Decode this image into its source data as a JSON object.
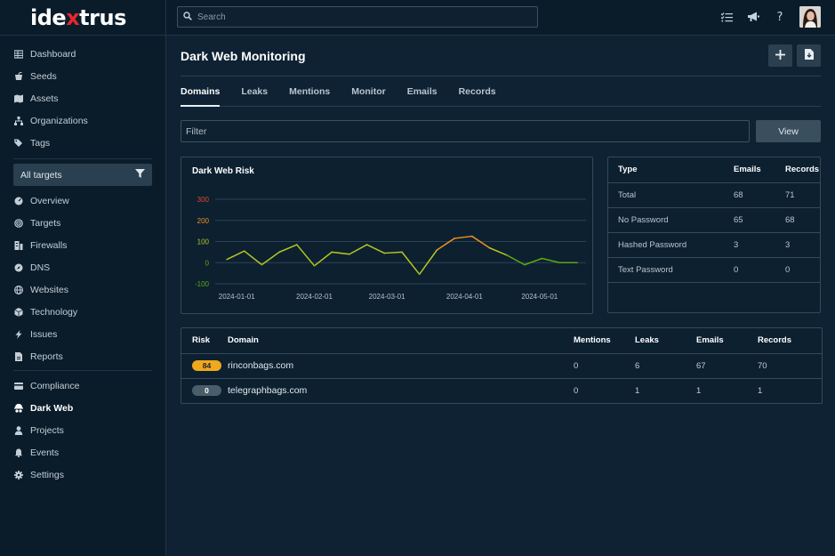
{
  "brand": {
    "logo_before": "ide",
    "logo_x": "x",
    "logo_after": "trus"
  },
  "search": {
    "placeholder": "Search"
  },
  "sidebar": {
    "group1": [
      {
        "label": "Dashboard",
        "icon": "grid-icon"
      },
      {
        "label": "Seeds",
        "icon": "seed-pot-icon"
      },
      {
        "label": "Assets",
        "icon": "map-icon"
      },
      {
        "label": "Organizations",
        "icon": "sitemap-icon"
      },
      {
        "label": "Tags",
        "icon": "tags-icon"
      }
    ],
    "target_select": "All targets",
    "group2": [
      {
        "label": "Overview",
        "icon": "gauge-icon"
      },
      {
        "label": "Targets",
        "icon": "target-icon"
      },
      {
        "label": "Firewalls",
        "icon": "firewall-icon"
      },
      {
        "label": "DNS",
        "icon": "compass-icon"
      },
      {
        "label": "Websites",
        "icon": "globe-icon"
      },
      {
        "label": "Technology",
        "icon": "cube-icon"
      },
      {
        "label": "Issues",
        "icon": "bolt-icon"
      },
      {
        "label": "Reports",
        "icon": "report-icon"
      }
    ],
    "group3": [
      {
        "label": "Compliance",
        "icon": "card-icon"
      },
      {
        "label": "Dark Web",
        "icon": "spy-icon",
        "active": true
      },
      {
        "label": "Projects",
        "icon": "person-icon"
      },
      {
        "label": "Events",
        "icon": "bell-icon"
      },
      {
        "label": "Settings",
        "icon": "gear-icon"
      }
    ]
  },
  "header": {
    "title": "Dark Web Monitoring"
  },
  "tabs": [
    "Domains",
    "Leaks",
    "Mentions",
    "Monitor",
    "Emails",
    "Records"
  ],
  "filter": {
    "placeholder": "Filter",
    "button": "View"
  },
  "chart_data": {
    "type": "line",
    "title": "Dark Web Risk",
    "x_ticks": [
      "2024-01-01",
      "2024-02-01",
      "2024-03-01",
      "2024-04-01",
      "2024-05-01"
    ],
    "y_ticks": [
      300,
      200,
      100,
      0,
      -100
    ],
    "ylim": [
      -100,
      300
    ],
    "grid": true,
    "x": [
      "2023-12-28",
      "2024-01-04",
      "2024-01-11",
      "2024-01-18",
      "2024-01-25",
      "2024-02-01",
      "2024-02-08",
      "2024-02-15",
      "2024-02-22",
      "2024-02-29",
      "2024-03-07",
      "2024-03-14",
      "2024-03-21",
      "2024-03-28",
      "2024-04-04",
      "2024-04-11",
      "2024-04-18",
      "2024-04-25",
      "2024-05-02",
      "2024-05-09",
      "2024-05-16"
    ],
    "values": [
      15,
      55,
      -10,
      50,
      85,
      -15,
      50,
      40,
      85,
      45,
      50,
      -55,
      60,
      115,
      125,
      70,
      35,
      -10,
      20,
      0,
      0
    ],
    "color_scale": {
      "low": "#5da80e",
      "mid": "#b6c51e",
      "high": "#f08d22",
      "top": "#e2462a"
    }
  },
  "stats_table": {
    "columns": [
      "Type",
      "Emails",
      "Records"
    ],
    "rows": [
      [
        "Total",
        "68",
        "71"
      ],
      [
        "No Password",
        "65",
        "68"
      ],
      [
        "Hashed Password",
        "3",
        "3"
      ],
      [
        "Text Password",
        "0",
        "0"
      ]
    ]
  },
  "domains_table": {
    "columns": [
      "Risk",
      "Domain",
      "Mentions",
      "Leaks",
      "Emails",
      "Records"
    ],
    "rows": [
      {
        "risk": "84",
        "risk_color": "#f0a81c",
        "risk_text": "#1a2230",
        "domain": "rinconbags.com",
        "mentions": "0",
        "leaks": "6",
        "emails": "67",
        "records": "70"
      },
      {
        "risk": "0",
        "risk_color": "#4a5d6b",
        "risk_text": "#ffffff",
        "domain": "telegraphbags.com",
        "mentions": "0",
        "leaks": "1",
        "emails": "1",
        "records": "1"
      }
    ]
  }
}
